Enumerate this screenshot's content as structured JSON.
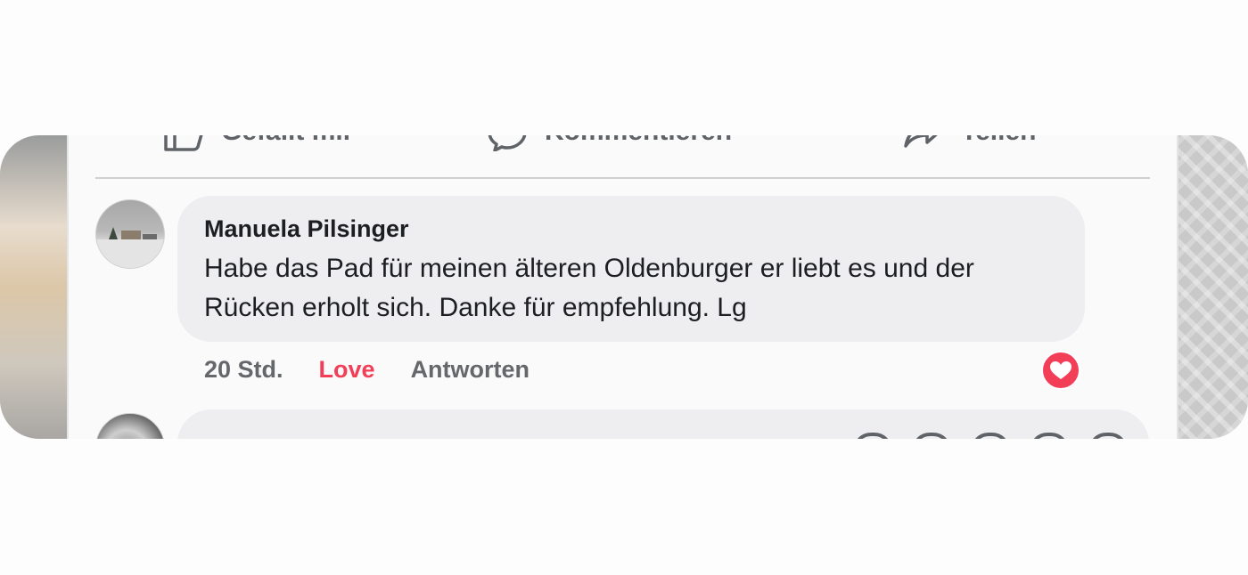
{
  "actions": {
    "like_label": "Gefällt mir",
    "comment_label": "Kommentieren",
    "share_label": "Teilen"
  },
  "comment": {
    "author": "Manuela Pilsinger",
    "text": "Habe das Pad für meinen älteren Oldenburger er liebt es und der Rücken erholt sich. Danke für empfehlung. Lg",
    "time": "20 Std.",
    "reaction_label": "Love",
    "reply_label": "Antworten",
    "reaction_icon": "heart-icon",
    "reaction_color": "#f33e58"
  },
  "next_comment": {
    "text": ""
  }
}
